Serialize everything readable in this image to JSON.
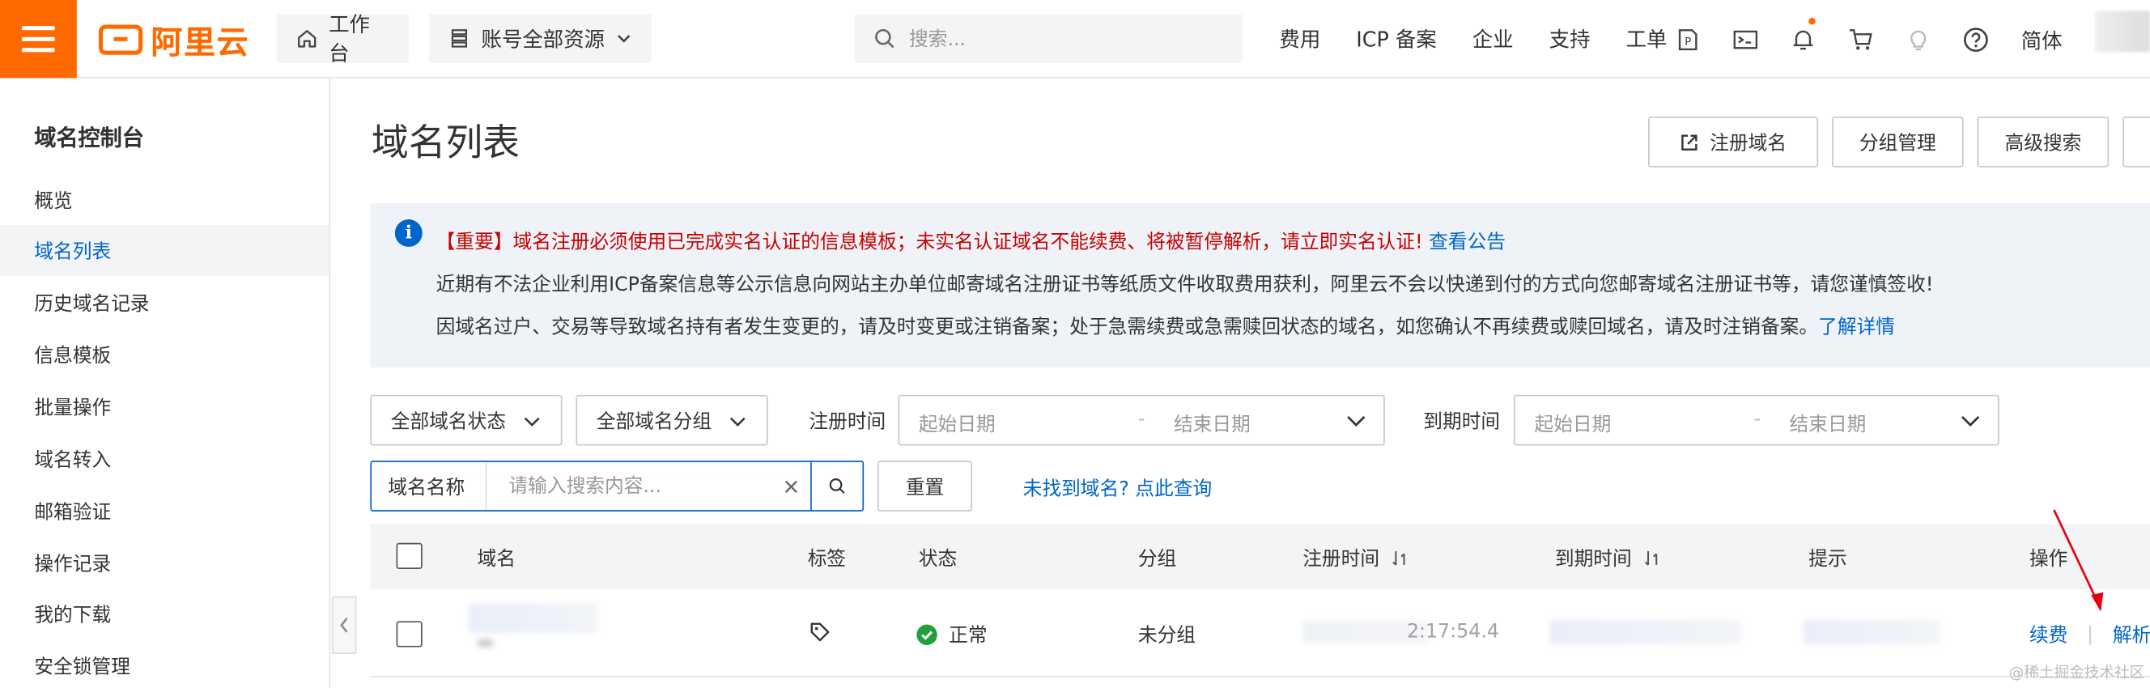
{
  "topbar": {
    "logo_text": "阿里云",
    "workbench": "工作台",
    "resources": "账号全部资源",
    "search_placeholder": "搜索...",
    "links": [
      "费用",
      "ICP 备案",
      "企业",
      "支持",
      "工单"
    ],
    "lang": "简体"
  },
  "sidebar": {
    "title": "域名控制台",
    "items": [
      "概览",
      "域名列表",
      "历史域名记录",
      "信息模板",
      "批量操作",
      "域名转入",
      "邮箱验证",
      "操作记录",
      "我的下载",
      "安全锁管理"
    ],
    "active_index": 1
  },
  "main": {
    "title": "域名列表",
    "buttons": {
      "register": "注册域名",
      "group_manage": "分组管理",
      "advanced_search": "高级搜索"
    },
    "notice": {
      "warn": "【重要】域名注册必须使用已完成实名认证的信息模板；未实名认证域名不能续费、将被暂停解析，请立即实名认证!",
      "warn_link": "查看公告",
      "line2": "近期有不法企业利用ICP备案信息等公示信息向网站主办单位邮寄域名注册证书等纸质文件收取费用获利，阿里云不会以快递到付的方式向您邮寄域名注册证书等，请您谨慎签收!",
      "line3": "因域名过户、交易等导致域名持有者发生变更的，请及时变更或注销备案；处于急需续费或急需赎回状态的域名，如您确认不再续费或赎回域名，请及时注销备案。",
      "line3_link": "了解详情"
    },
    "filters": {
      "status": "全部域名状态",
      "group": "全部域名分组",
      "reg_time_label": "注册时间",
      "exp_time_label": "到期时间",
      "start_date": "起始日期",
      "end_date": "结束日期",
      "date_sep": "-",
      "search_label": "域名名称",
      "search_placeholder": "请输入搜索内容...",
      "reset": "重置",
      "not_found": "未找到域名? 点此查询"
    },
    "table": {
      "headers": [
        "域名",
        "标签",
        "状态",
        "分组",
        "注册时间",
        "到期时间",
        "提示",
        "操作"
      ],
      "row": {
        "status": "正常",
        "group": "未分组",
        "reg_time_partial": "2:17:54.4",
        "actions": [
          "续费",
          "解析"
        ]
      }
    }
  },
  "watermark": "@稀土掘金技术社区",
  "colors": {
    "brand": "#ff6a00",
    "link": "#0064c8",
    "warn": "#c80000",
    "ok": "#23a03c"
  }
}
